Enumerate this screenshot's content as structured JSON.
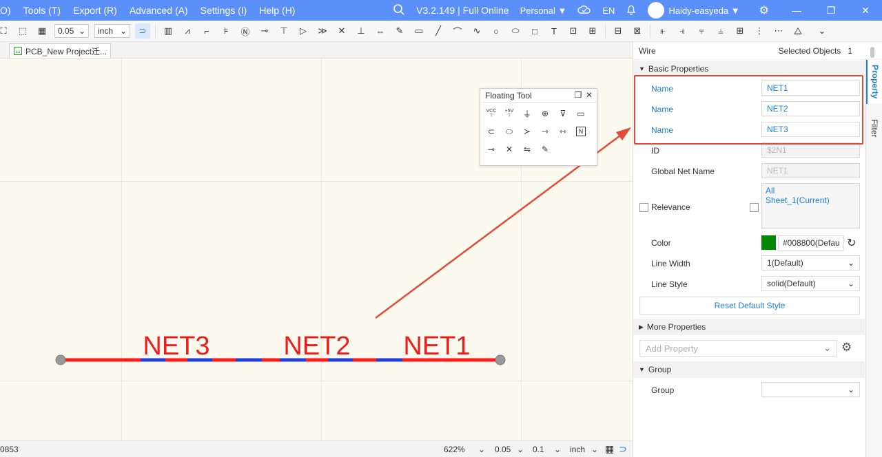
{
  "menubar": {
    "items": [
      "O)",
      "Tools (T)",
      "Export (R)",
      "Advanced (A)",
      "Settings (I)",
      "Help (H)"
    ],
    "version": "V3.2.149 | Full Online",
    "edition": "Personal",
    "language": "EN",
    "user": "Haidy-easyeda"
  },
  "toolbar": {
    "grid_size": "0.05",
    "unit": "inch"
  },
  "tabs": {
    "document": "PCB_New Project迁..."
  },
  "floating_tool": {
    "title": "Floating Tool",
    "icons": [
      "vcc-icon",
      "plus5v-icon",
      "ground-icon",
      "earth-icon",
      "netport-down-icon",
      "netport-right-icon",
      "netport-in-icon",
      "netport-bidir-icon",
      "bus-entry-icon",
      "net-arrow-icon",
      "net-flag-icon",
      "netlabel-n-icon",
      "junction-icon",
      "no-connect-icon",
      "diff-pair-icon",
      "pen-wire-icon"
    ],
    "vcc_text": "VCC",
    "plus5v_text": "+5V",
    "n_text": "N"
  },
  "canvas": {
    "labels": [
      "NET3",
      "NET2",
      "NET1"
    ],
    "wire_color": "#ff1a1a",
    "dash_color": "#1f3fd6"
  },
  "statusbar": {
    "coord": "0853",
    "zoom": "622%",
    "grid": "0.05",
    "snap": "0.1",
    "unit": "inch"
  },
  "panel": {
    "type": "Wire",
    "selected_label": "Selected Objects",
    "selected_count": "1",
    "basic_section": "Basic Properties",
    "fields": {
      "name1_label": "Name",
      "name1_value": "NET1",
      "name2_label": "Name",
      "name2_value": "NET2",
      "name3_label": "Name",
      "name3_value": "NET3",
      "id_label": "ID",
      "id_value": "$2N1",
      "global_label": "Global Net Name",
      "global_value": "NET1",
      "relevance_label": "Relevance",
      "relevance_options": [
        "All",
        "Sheet_1(Current)"
      ],
      "color_label": "Color",
      "color_value": "#008800(Defau",
      "color_swatch": "#008800",
      "width_label": "Line Width",
      "width_value": "1(Default)",
      "style_label": "Line Style",
      "style_value": "solid(Default)"
    },
    "reset_button": "Reset Default Style",
    "more_section": "More Properties",
    "add_property_placeholder": "Add Property",
    "group_section": "Group",
    "group_label": "Group",
    "group_value": ""
  },
  "side_tabs": [
    "Property",
    "Filter"
  ],
  "colors": {
    "accent": "#5b8ff9",
    "highlight": "#e04b3b",
    "link": "#1e7ed6"
  }
}
